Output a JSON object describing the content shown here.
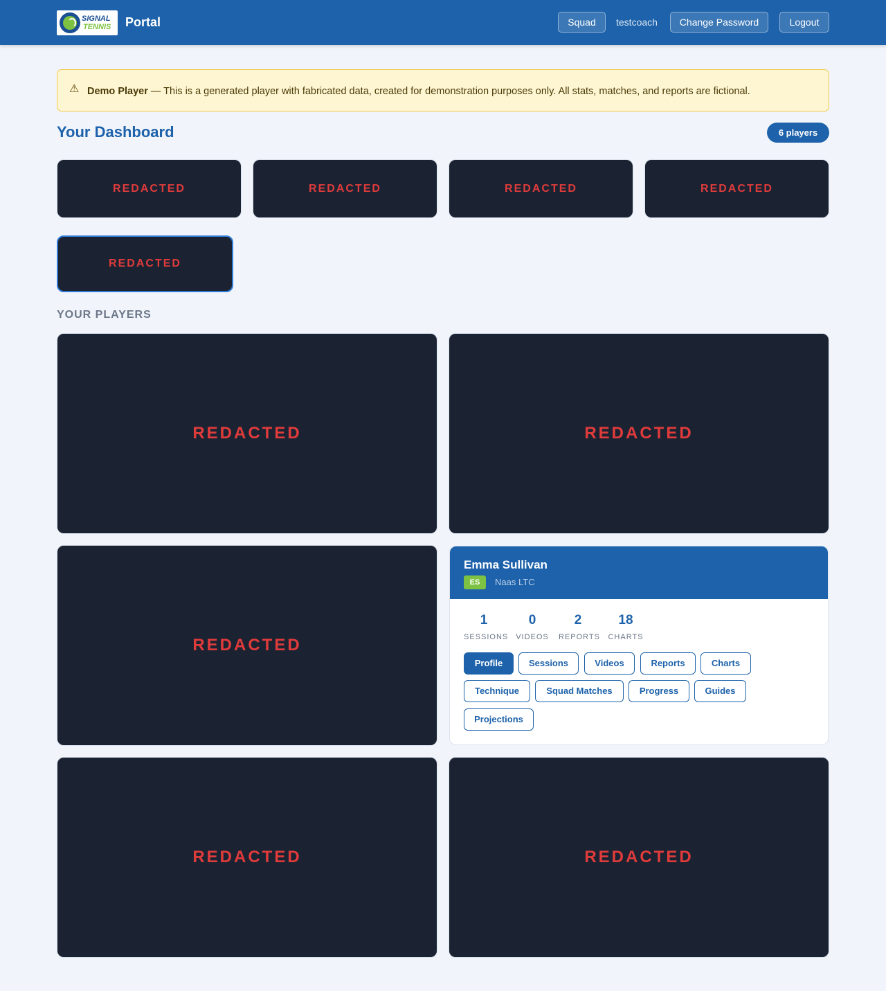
{
  "header": {
    "logo": {
      "line1": "SIGNAL",
      "line2": "TENNIS"
    },
    "title": "Portal",
    "nav": {
      "squad": "Squad",
      "username": "testcoach",
      "change_password": "Change Password",
      "logout": "Logout"
    }
  },
  "notice": {
    "icon": "⚠",
    "strong": "Demo Player",
    "text": " — This is a generated player with fabricated data, created for demonstration purposes only. All stats, matches, and reports are fictional."
  },
  "dashboard": {
    "title": "Your Dashboard",
    "player_count": "6 players",
    "tiles": [
      "REDACTED",
      "REDACTED",
      "REDACTED",
      "REDACTED",
      "REDACTED"
    ]
  },
  "players": {
    "section_label": "YOUR PLAYERS",
    "redacted_label": "REDACTED",
    "card": {
      "name": "Emma Sullivan",
      "initials": "ES",
      "club": "Naas LTC",
      "stats": [
        {
          "value": "1",
          "label": "SESSIONS"
        },
        {
          "value": "0",
          "label": "VIDEOS"
        },
        {
          "value": "2",
          "label": "REPORTS"
        },
        {
          "value": "18",
          "label": "CHARTS"
        }
      ],
      "actions": [
        "Profile",
        "Sessions",
        "Videos",
        "Reports",
        "Charts",
        "Technique",
        "Squad Matches",
        "Progress",
        "Guides",
        "Projections"
      ]
    }
  },
  "colors": {
    "primary": "#1d62aa",
    "accent_green": "#7dc242",
    "redacted_bg": "#1b2333",
    "redacted_text": "#e03b3b",
    "notice_bg": "#fef6d2"
  }
}
